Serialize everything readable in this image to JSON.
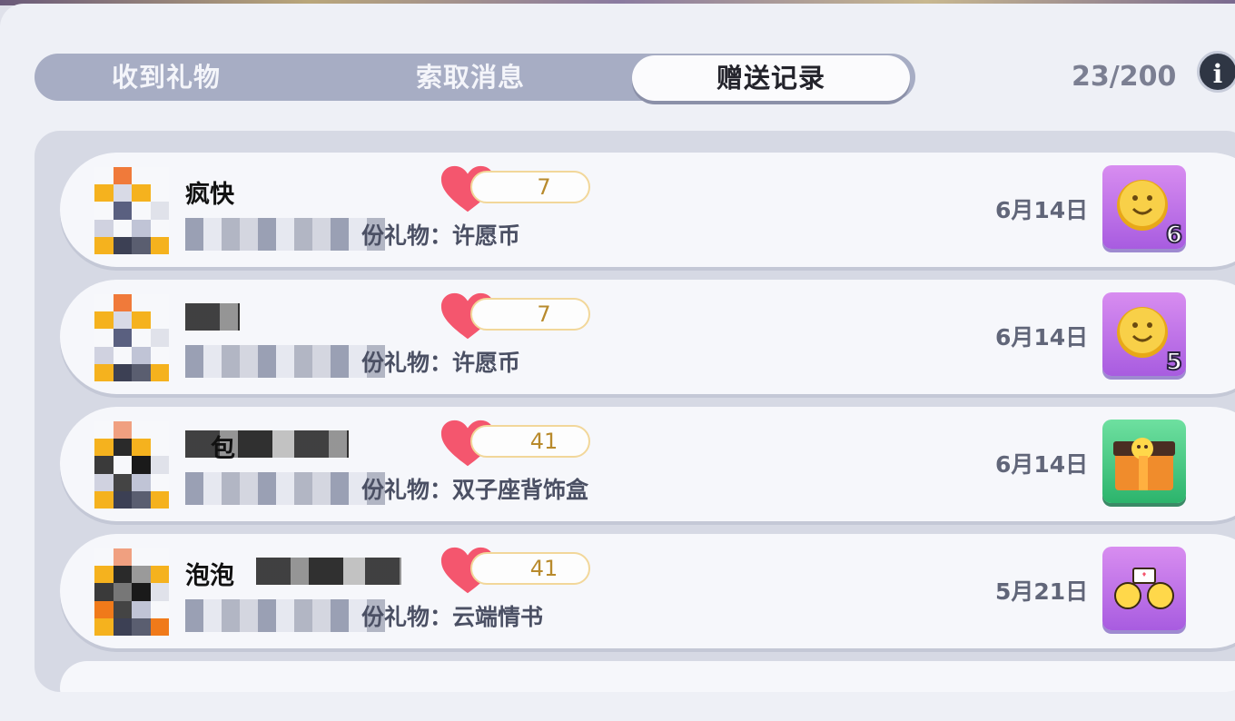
{
  "tabs": [
    "收到礼物",
    "索取消息",
    "赠送记录"
  ],
  "active_tab": "赠送记录",
  "counter": "23/200",
  "info_icon": "i",
  "records": [
    {
      "name": "疯快",
      "hearts": "7",
      "gift": "份礼物：许愿币",
      "date": "6月14日",
      "icon": "wish-coin-icon",
      "qty": "6"
    },
    {
      "name": "",
      "hearts": "7",
      "gift": "份礼物：许愿币",
      "date": "6月14日",
      "icon": "wish-coin-icon",
      "qty": "5"
    },
    {
      "name": "包",
      "hearts": "41",
      "gift": "份礼物：双子座背饰盒",
      "date": "6月14日",
      "icon": "gift-box-icon",
      "qty": ""
    },
    {
      "name": "泡泡",
      "hearts": "41",
      "gift": "份礼物：云端情书",
      "date": "5月21日",
      "icon": "love-letter-icon",
      "qty": ""
    }
  ],
  "colors": {
    "heart": "#f4566e",
    "tab_bar": "#a7adc4",
    "coin": "#f5c43c"
  }
}
